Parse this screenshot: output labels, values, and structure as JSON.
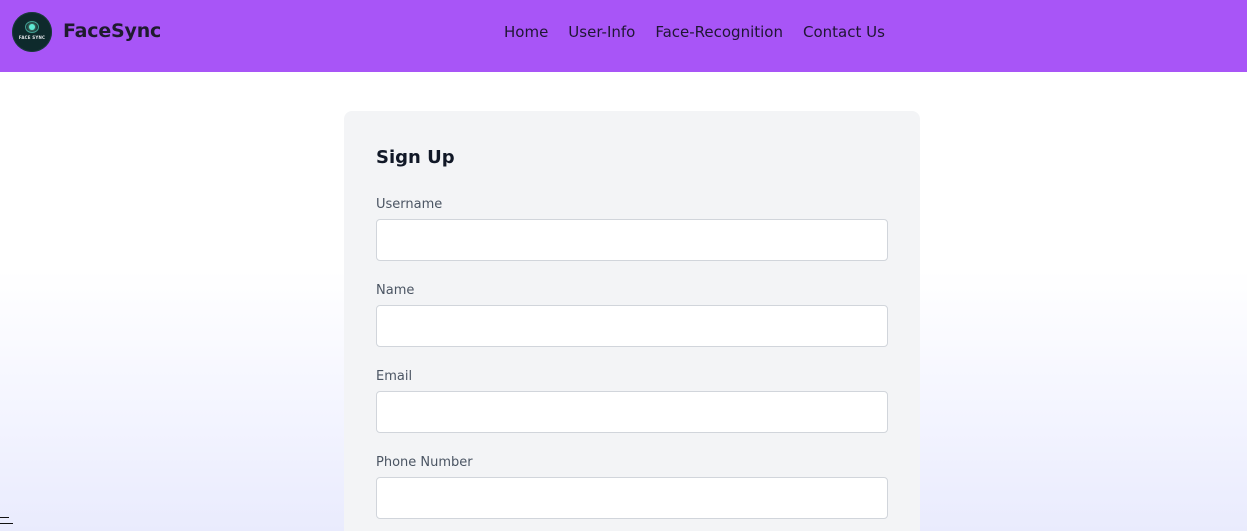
{
  "navbar": {
    "logo_text": "FACE SYNC",
    "brand": "FaceSync",
    "links": [
      "Home",
      "User-Info",
      "Face-Recognition",
      "Contact Us"
    ],
    "background_color": "#a855f7"
  },
  "signup": {
    "title": "Sign Up",
    "fields": [
      {
        "label": "Username",
        "value": "",
        "placeholder": ""
      },
      {
        "label": "Name",
        "value": "",
        "placeholder": ""
      },
      {
        "label": "Email",
        "value": "",
        "placeholder": ""
      },
      {
        "label": "Phone Number",
        "value": "",
        "placeholder": ""
      }
    ]
  },
  "icons": {
    "logo": "facesync-logo-icon",
    "corner": "menu-icon"
  }
}
